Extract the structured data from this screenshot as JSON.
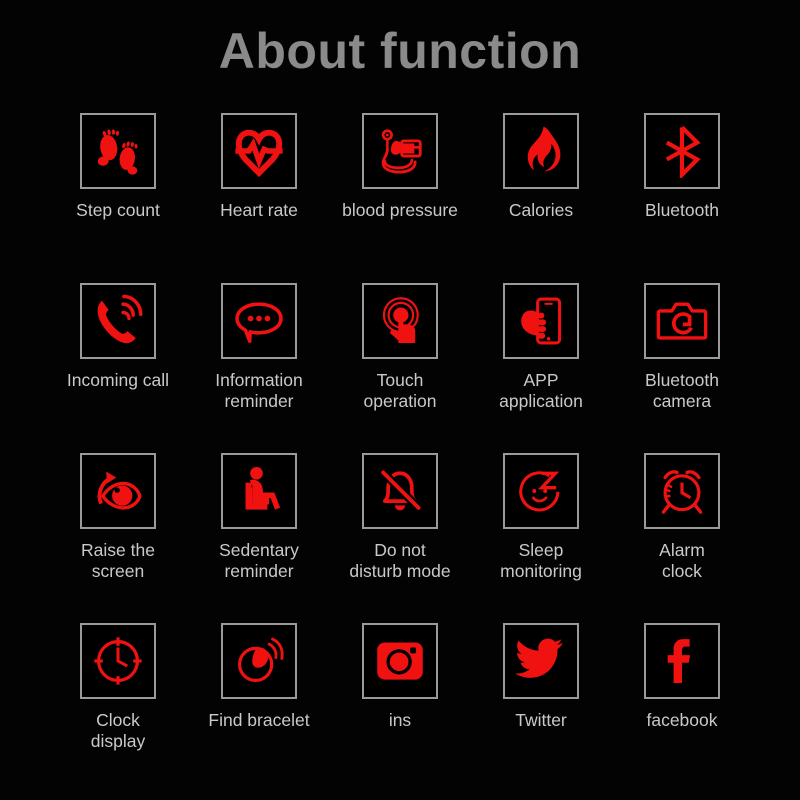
{
  "page": {
    "title": "About function",
    "background_color": "#030303",
    "accent_color": "#F01111",
    "title_color": "#8a8a8a",
    "label_color": "#c9c9c9",
    "box_border_color": "#9a9a9a"
  },
  "grid": {
    "columns": 5,
    "rows": 4,
    "items": [
      {
        "id": "step-count",
        "label": "Step count",
        "icon": "footprints-icon"
      },
      {
        "id": "heart-rate",
        "label": "Heart rate",
        "icon": "heart-pulse-icon"
      },
      {
        "id": "blood-pressure",
        "label": "blood pressure",
        "icon": "blood-pressure-monitor-icon"
      },
      {
        "id": "calories",
        "label": "Calories",
        "icon": "flame-icon"
      },
      {
        "id": "bluetooth",
        "label": "Bluetooth",
        "icon": "bluetooth-icon"
      },
      {
        "id": "incoming-call",
        "label": "Incoming call",
        "icon": "ringing-phone-icon"
      },
      {
        "id": "information-reminder",
        "label": "Information\nreminder",
        "icon": "speech-bubble-icon"
      },
      {
        "id": "touch-operation",
        "label": "Touch\noperation",
        "icon": "touch-hand-icon"
      },
      {
        "id": "app-application",
        "label": "APP\napplication",
        "icon": "hand-holding-phone-icon"
      },
      {
        "id": "bluetooth-camera",
        "label": "Bluetooth\ncamera",
        "icon": "camera-icon"
      },
      {
        "id": "raise-the-screen",
        "label": "Raise the\nscreen",
        "icon": "eye-rotate-icon"
      },
      {
        "id": "sedentary-reminder",
        "label": "Sedentary\nreminder",
        "icon": "seated-person-icon"
      },
      {
        "id": "do-not-disturb",
        "label": "Do not\ndisturb mode",
        "icon": "bell-slash-icon"
      },
      {
        "id": "sleep-monitoring",
        "label": "Sleep\nmonitoring",
        "icon": "sleep-face-z-icon"
      },
      {
        "id": "alarm-clock",
        "label": "Alarm\nclock",
        "icon": "alarm-clock-icon"
      },
      {
        "id": "clock-display",
        "label": "Clock\ndisplay",
        "icon": "clock-icon"
      },
      {
        "id": "find-bracelet",
        "label": "Find bracelet",
        "icon": "bracelet-signal-icon"
      },
      {
        "id": "ins",
        "label": "ins",
        "icon": "instagram-icon"
      },
      {
        "id": "twitter",
        "label": "Twitter",
        "icon": "twitter-bird-icon"
      },
      {
        "id": "facebook",
        "label": "facebook",
        "icon": "facebook-f-icon"
      }
    ]
  }
}
